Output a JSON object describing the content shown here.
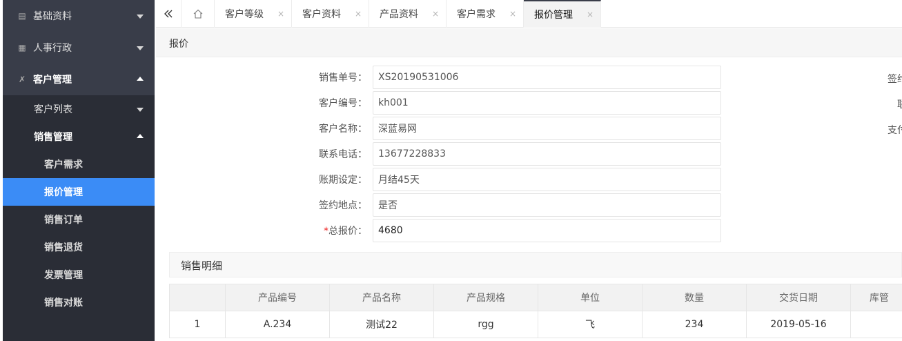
{
  "sidebar": {
    "groups": [
      {
        "label": "基础资料",
        "icon": "list-icon"
      },
      {
        "label": "人事行政",
        "icon": "grid-icon"
      },
      {
        "label": "客户管理",
        "icon": "tools-icon"
      }
    ],
    "sub": [
      {
        "label": "客户列表"
      },
      {
        "label": "销售管理"
      }
    ],
    "items": [
      {
        "label": "客户需求"
      },
      {
        "label": "报价管理"
      },
      {
        "label": "销售订单"
      },
      {
        "label": "销售退货"
      },
      {
        "label": "发票管理"
      },
      {
        "label": "销售对账"
      }
    ]
  },
  "tabs": {
    "collapse_icon": "double-chevron-left-icon",
    "home_icon": "home-icon",
    "items": [
      {
        "label": "客户等级"
      },
      {
        "label": "客户资料"
      },
      {
        "label": "产品资料"
      },
      {
        "label": "客户需求"
      },
      {
        "label": "报价管理"
      }
    ],
    "close_glyph": "×"
  },
  "header": {
    "title": "报价"
  },
  "form": {
    "fields": [
      {
        "label": "销售单号：",
        "value": "XS20190531006"
      },
      {
        "label": "客户编号：",
        "value": "kh001"
      },
      {
        "label": "客户名称：",
        "value": "深蓝易网"
      },
      {
        "label": "联系电话：",
        "value": "13677228833"
      },
      {
        "label": "账期设定：",
        "value": "月结45天"
      },
      {
        "label": "签约地点：",
        "value": "是否"
      },
      {
        "label": "总报价：",
        "required_mark": "*",
        "value": "4680"
      }
    ],
    "right_labels": [
      "签约",
      "联",
      "支付"
    ]
  },
  "detail": {
    "title": "销售明细",
    "headers": [
      "",
      "产品编号",
      "产品名称",
      "产品规格",
      "单位",
      "数量",
      "交货日期",
      "库管"
    ],
    "rows": [
      [
        "1",
        "A.234",
        "测试22",
        "rgg",
        "飞",
        "234",
        "2019-05-16",
        ""
      ]
    ]
  },
  "colors": {
    "sidebar_bg": "#393d49",
    "sidebar_sub_bg": "#2a2d36",
    "active_blue": "#3b8cf6",
    "required_red": "#ee2222"
  }
}
